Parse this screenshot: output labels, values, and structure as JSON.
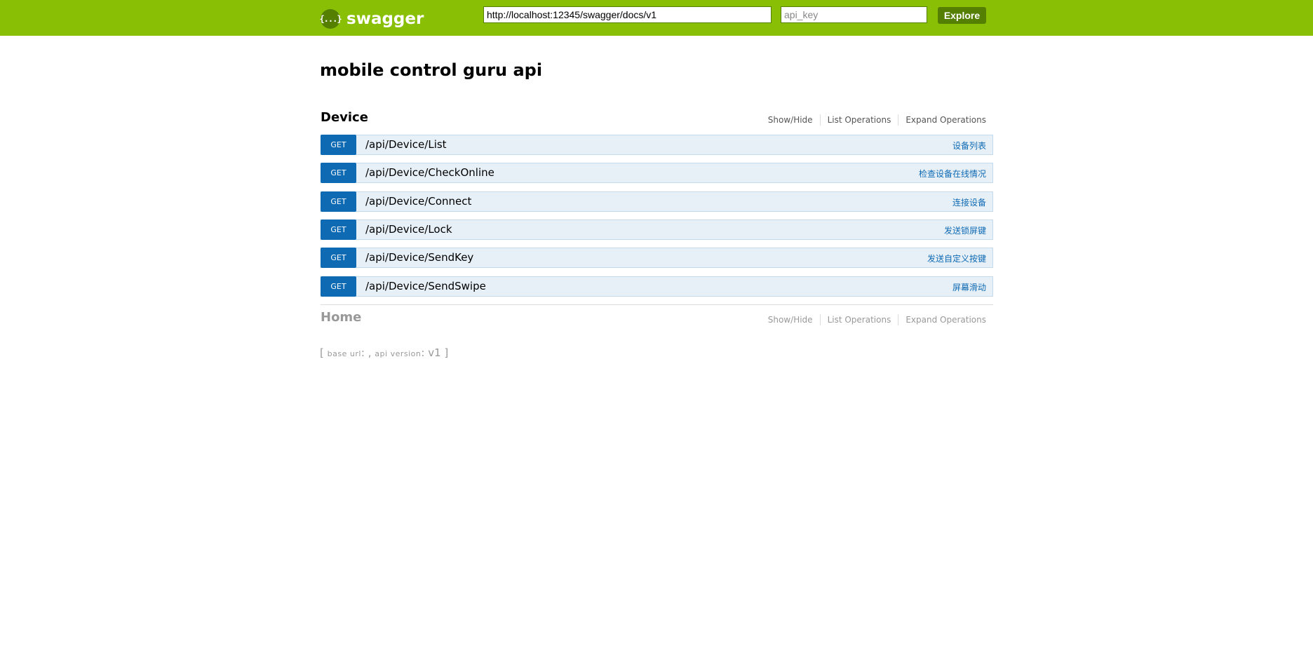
{
  "header": {
    "logo_text": "swagger",
    "logo_icon": "swagger-braces-icon",
    "url_value": "http://localhost:12345/swagger/docs/v1",
    "api_key_placeholder": "api_key",
    "explore_label": "Explore",
    "background_color": "#89bf04",
    "accent_color": "#547f00"
  },
  "api_title": "mobile control guru api",
  "resources": [
    {
      "name": "Device",
      "links": {
        "show_hide": "Show/Hide",
        "list_operations": "List Operations",
        "expand_operations": "Expand Operations"
      },
      "operations": [
        {
          "method": "GET",
          "path": "/api/Device/List",
          "summary": "设备列表"
        },
        {
          "method": "GET",
          "path": "/api/Device/CheckOnline",
          "summary": "检查设备在线情况"
        },
        {
          "method": "GET",
          "path": "/api/Device/Connect",
          "summary": "连接设备"
        },
        {
          "method": "GET",
          "path": "/api/Device/Lock",
          "summary": "发送锁屏键"
        },
        {
          "method": "GET",
          "path": "/api/Device/SendKey",
          "summary": "发送自定义按键"
        },
        {
          "method": "GET",
          "path": "/api/Device/SendSwipe",
          "summary": "屏幕滑动"
        }
      ]
    },
    {
      "name": "Home",
      "links": {
        "show_hide": "Show/Hide",
        "list_operations": "List Operations",
        "expand_operations": "Expand Operations"
      }
    }
  ],
  "footer": {
    "open_bracket": "[",
    "base_url_label": "base url",
    "base_url_value": ": ,",
    "api_version_label": "api version",
    "api_version_value": ": v1",
    "close_bracket": "]"
  },
  "colors": {
    "get_method": "#0f6ab4",
    "operation_bg": "#e7f0f7",
    "operation_border": "#c3d9ec"
  }
}
